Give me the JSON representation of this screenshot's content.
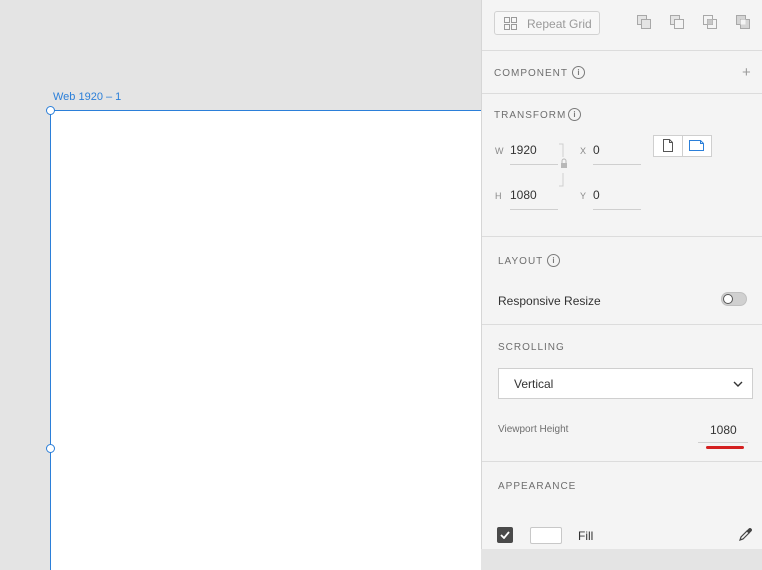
{
  "canvas": {
    "artboard_title": "Web 1920 – 1"
  },
  "panel": {
    "repeat_grid_label": "Repeat Grid",
    "boolean_icons": [
      "add-icon",
      "subtract-icon",
      "intersect-icon",
      "exclude-icon"
    ],
    "component": {
      "label": "COMPONENT",
      "add_icon": "+"
    },
    "transform": {
      "label": "TRANSFORM",
      "w_label": "W",
      "w_value": "1920",
      "h_label": "H",
      "h_value": "1080",
      "x_label": "X",
      "x_value": "0",
      "y_label": "Y",
      "y_value": "0"
    },
    "layout": {
      "label": "LAYOUT",
      "responsive_resize_label": "Responsive Resize",
      "responsive_resize_enabled": false
    },
    "scrolling": {
      "label": "SCROLLING",
      "selected": "Vertical",
      "viewport_height_label": "Viewport Height",
      "viewport_height_value": "1080"
    },
    "appearance": {
      "label": "APPEARANCE",
      "fill_label": "Fill",
      "fill_checked": true,
      "fill_color": "#ffffff"
    },
    "accent_color": "#2b7fd9",
    "annotation_color": "#d42020"
  }
}
